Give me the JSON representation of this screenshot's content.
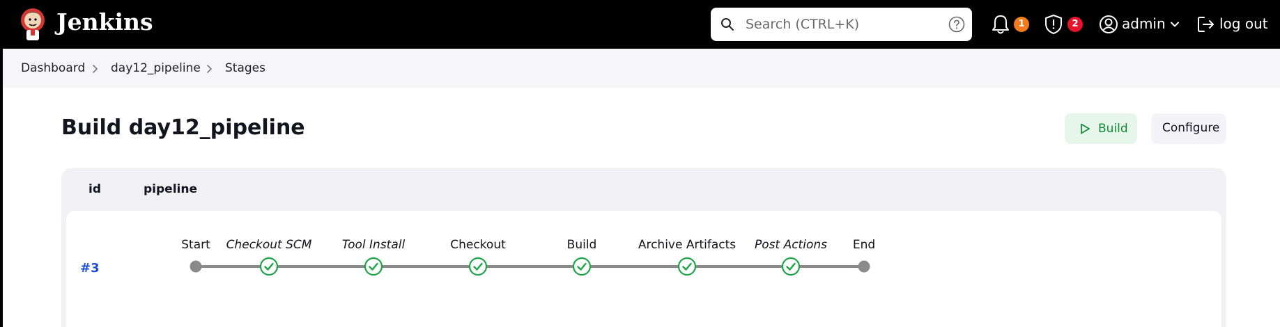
{
  "header": {
    "brand": "Jenkins",
    "search_placeholder": "Search (CTRL+K)",
    "notifications_count": "1",
    "security_count": "2",
    "user": "admin",
    "logout": "log out"
  },
  "breadcrumb": [
    "Dashboard",
    "day12_pipeline",
    "Stages"
  ],
  "page": {
    "title": "Build day12_pipeline",
    "build_button": "Build",
    "configure_button": "Configure"
  },
  "table": {
    "col_id": "id",
    "col_pipeline": "pipeline",
    "runs": [
      {
        "id": "#3",
        "stages": [
          {
            "label": "Start",
            "kind": "endpoint",
            "italic": false
          },
          {
            "label": "Checkout SCM",
            "kind": "success",
            "italic": true
          },
          {
            "label": "Tool Install",
            "kind": "success",
            "italic": true
          },
          {
            "label": "Checkout",
            "kind": "success",
            "italic": false
          },
          {
            "label": "Build",
            "kind": "success",
            "italic": false
          },
          {
            "label": "Archive Artifacts",
            "kind": "success",
            "italic": false
          },
          {
            "label": "Post Actions",
            "kind": "success",
            "italic": true
          },
          {
            "label": "End",
            "kind": "endpoint",
            "italic": false
          }
        ]
      }
    ]
  },
  "colors": {
    "success": "#1ea446",
    "endpoint": "#8a8a8a",
    "line": "#8a8a8a",
    "link": "#1d4fd8"
  }
}
